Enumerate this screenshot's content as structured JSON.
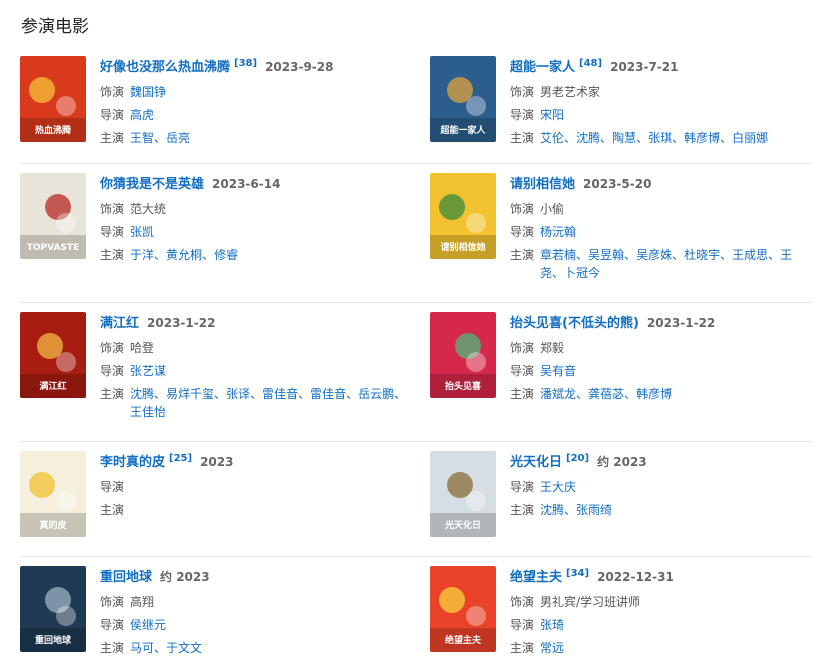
{
  "section_title": "参演电影",
  "films": [
    {
      "title": "好像也没那么热血沸腾",
      "cite": "[38]",
      "date": "2023-9-28",
      "role_label": "饰演",
      "role": "魏国铮",
      "role_is_link": true,
      "director_label": "导演",
      "directors": [
        "高虎"
      ],
      "cast_label": "主演",
      "cast": [
        "王智",
        "岳亮"
      ],
      "poster": {
        "bg": "#d93a1c",
        "accent": "#f6c13a",
        "text": "热血沸腾"
      }
    },
    {
      "title": "超能一家人",
      "cite": "[48]",
      "date": "2023-7-21",
      "role_label": "饰演",
      "role": "男老艺术家",
      "role_is_link": false,
      "director_label": "导演",
      "directors": [
        "宋阳"
      ],
      "cast_label": "主演",
      "cast": [
        "艾伦",
        "沈腾",
        "陶慧",
        "张琪",
        "韩彦博",
        "白丽娜"
      ],
      "poster": {
        "bg": "#2b5e8c",
        "accent": "#e0a33c",
        "text": "超能一家人"
      }
    },
    {
      "title": "你猜我是不是英雄",
      "cite": "",
      "date": "2023-6-14",
      "role_label": "饰演",
      "role": "范大统",
      "role_is_link": false,
      "director_label": "导演",
      "directors": [
        "张凯"
      ],
      "cast_label": "主演",
      "cast": [
        "于洋",
        "黄允桐",
        "修睿"
      ],
      "poster": {
        "bg": "#e9e4da",
        "accent": "#b52a25",
        "text": "TOPVASTE"
      }
    },
    {
      "title": "请别相信她",
      "cite": "",
      "date": "2023-5-20",
      "role_label": "饰演",
      "role": "小偷",
      "role_is_link": false,
      "director_label": "导演",
      "directors": [
        "杨沅翰"
      ],
      "cast_label": "主演",
      "cast": [
        "章若楠",
        "吴昱翰",
        "吴彦姝",
        "杜晓宇",
        "王成思",
        "王尧",
        "卜冠今"
      ],
      "poster": {
        "bg": "#f2c230",
        "accent": "#3a8a3a",
        "text": "请别相信她"
      }
    },
    {
      "title": "满江红",
      "cite": "",
      "date": "2023-1-22",
      "role_label": "饰演",
      "role": "哈登",
      "role_is_link": false,
      "director_label": "导演",
      "directors": [
        "张艺谋"
      ],
      "cast_label": "主演",
      "cast": [
        "沈腾",
        "易烊千玺",
        "张译",
        "雷佳音",
        "雷佳音",
        "岳云鹏",
        "王佳怡"
      ],
      "poster": {
        "bg": "#a81d12",
        "accent": "#f1b845",
        "text": "满江红"
      }
    },
    {
      "title": "抬头见喜(不低头的熊)",
      "cite": "",
      "date": "2023-1-22",
      "role_label": "饰演",
      "role": "郑毅",
      "role_is_link": false,
      "director_label": "导演",
      "directors": [
        "吴有音"
      ],
      "cast_label": "主演",
      "cast": [
        "潘斌龙",
        "龚蓓苾",
        "韩彦博"
      ],
      "poster": {
        "bg": "#d6284b",
        "accent": "#4bb77a",
        "text": "抬头见喜"
      }
    },
    {
      "title": "李时真的皮",
      "cite": "[25]",
      "date": "2023",
      "role_label": "",
      "role": "",
      "role_is_link": false,
      "director_label": "导演",
      "directors": [],
      "cast_label": "主演",
      "cast": [],
      "poster": {
        "bg": "#f5f0dd",
        "accent": "#f0c22f",
        "text": "真的皮"
      }
    },
    {
      "title": "光天化日",
      "cite": "[20]",
      "date": "约 2023",
      "role_label": "",
      "role": "",
      "role_is_link": false,
      "director_label": "导演",
      "directors": [
        "王大庆"
      ],
      "cast_label": "主演",
      "cast": [
        "沈腾",
        "张雨绮"
      ],
      "poster": {
        "bg": "#d7dee3",
        "accent": "#8a6b3a",
        "text": "光天化日"
      }
    },
    {
      "title": "重回地球",
      "cite": "",
      "date": "约 2023",
      "role_label": "饰演",
      "role": "高翔",
      "role_is_link": false,
      "director_label": "导演",
      "directors": [
        "侯继元"
      ],
      "cast_label": "主演",
      "cast": [
        "马可",
        "于文文"
      ],
      "poster": {
        "bg": "#1f3a52",
        "accent": "#9bb3c4",
        "text": "重回地球"
      }
    },
    {
      "title": "绝望主夫",
      "cite": "[34]",
      "date": "2022-12-31",
      "role_label": "饰演",
      "role": "男礼宾/学习班讲师",
      "role_is_link": false,
      "director_label": "导演",
      "directors": [
        "张琦"
      ],
      "cast_label": "主演",
      "cast": [
        "常远"
      ],
      "poster": {
        "bg": "#e9432a",
        "accent": "#f7d13c",
        "text": "绝望主夫"
      }
    }
  ]
}
